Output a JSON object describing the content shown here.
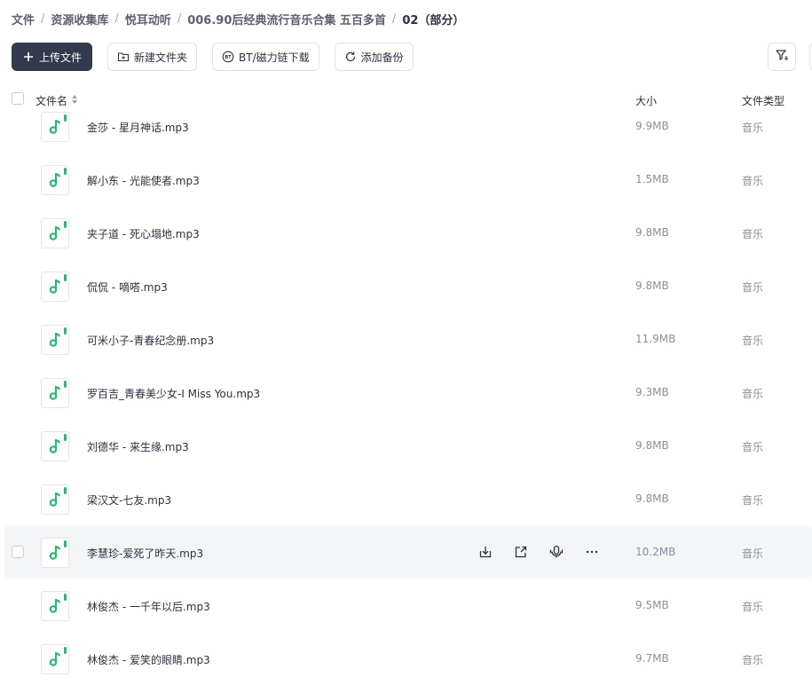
{
  "breadcrumb": {
    "items": [
      "文件",
      "资源收集库",
      "悦耳动听",
      "006.90后经典流行音乐合集 五百多首",
      "02（部分）"
    ],
    "separator": "/"
  },
  "toolbar": {
    "upload_label": "上传文件",
    "new_folder_label": "新建文件夹",
    "bt_label": "BT/磁力链下载",
    "backup_label": "添加备份"
  },
  "table": {
    "col_name": "文件名",
    "col_size": "大小",
    "col_type": "文件类型"
  },
  "colors": {
    "accent_dark": "#343a4d",
    "music_green": "#2bb673",
    "hover_row": "#f4f5f7"
  },
  "files": [
    {
      "name": "金莎 - 星月神话.mp3",
      "size": "9.9MB",
      "type": "音乐"
    },
    {
      "name": "解小东 - 光能使者.mp3",
      "size": "1.5MB",
      "type": "音乐"
    },
    {
      "name": "夹子道 - 死心塌地.mp3",
      "size": "9.8MB",
      "type": "音乐"
    },
    {
      "name": "侃侃 - 嘀嗒.mp3",
      "size": "9.8MB",
      "type": "音乐"
    },
    {
      "name": "可米小子-青春纪念册.mp3",
      "size": "11.9MB",
      "type": "音乐"
    },
    {
      "name": "罗百吉_青春美少女-I Miss You.mp3",
      "size": "9.3MB",
      "type": "音乐"
    },
    {
      "name": "刘德华 - 来生缘.mp3",
      "size": "9.8MB",
      "type": "音乐"
    },
    {
      "name": "梁汉文-七友.mp3",
      "size": "9.8MB",
      "type": "音乐"
    },
    {
      "name": "李慧珍-爱死了昨天.mp3",
      "size": "10.2MB",
      "type": "音乐"
    },
    {
      "name": "林俊杰 - 一千年以后.mp3",
      "size": "9.5MB",
      "type": "音乐"
    },
    {
      "name": "林俊杰 - 爱笑的眼睛.mp3",
      "size": "9.7MB",
      "type": "音乐"
    }
  ],
  "hover_index": 8,
  "icons": {
    "upload": "plus-icon",
    "new_folder": "folder-plus-icon",
    "bt": "bt-badge-icon",
    "backup": "sync-icon",
    "filter": "filter-icon",
    "file": "music-note-icon",
    "row_actions": [
      "download-icon",
      "share-icon",
      "audio-icon",
      "more-icon"
    ]
  }
}
